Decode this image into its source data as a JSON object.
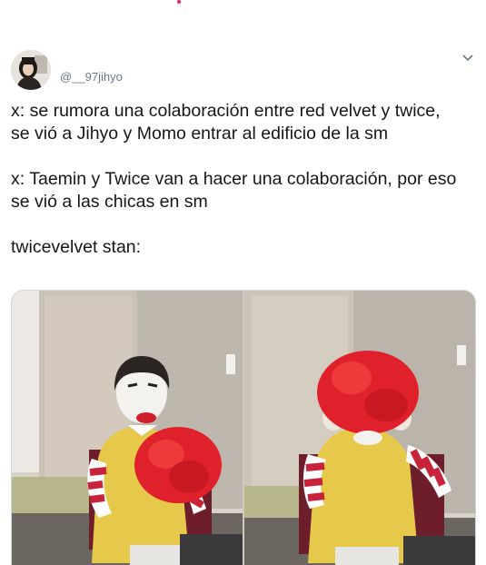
{
  "tweet": {
    "handle": "@__97jihyo",
    "lines": [
      "x: se rumora una colaboración entre red velvet y twice,",
      "se vió a Jihyo y Momo entrar al edificio de la sm",
      "x: Taemin y Twice van a hacer una colaboración, por eso",
      "se vió a las chicas en sm",
      "twicevelvet stan:"
    ]
  },
  "icons": {
    "menu": "chevron-down-icon",
    "avatar": "avatar-photo"
  },
  "media": {
    "images": [
      {
        "description_name": "clown-holding-wig"
      },
      {
        "description_name": "clown-wearing-wig"
      }
    ]
  },
  "colors": {
    "text": "#14171a",
    "secondary": "#657786",
    "border": "#ccd6dd"
  }
}
